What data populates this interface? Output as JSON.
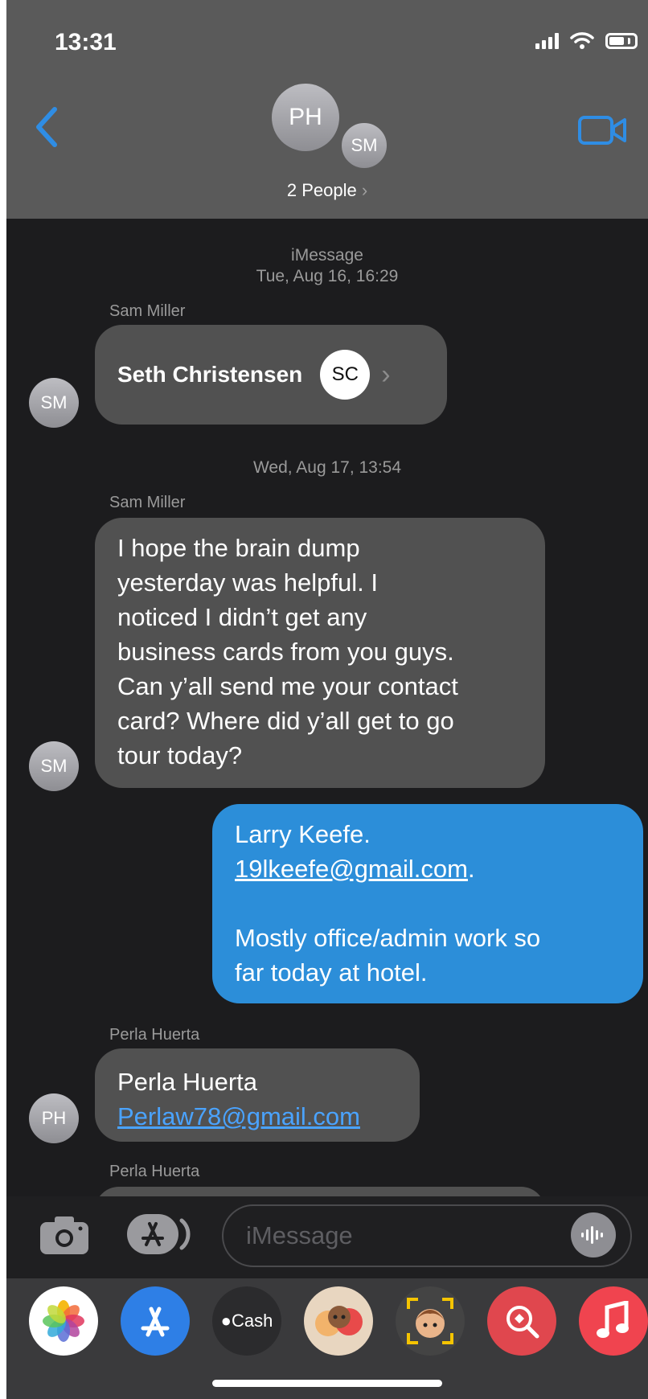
{
  "status": {
    "time": "13:31"
  },
  "header": {
    "avatar_primary": "PH",
    "avatar_secondary": "SM",
    "people_label": "2 People",
    "people_chevron": "›"
  },
  "conversation": {
    "service": "iMessage",
    "date1": "Tue, Aug 16, 16:29",
    "date2": "Wed, Aug 17, 13:54",
    "messages": [
      {
        "sender": "Sam Miller",
        "avatar": "SM",
        "type": "contact",
        "contact_name": "Seth Christensen",
        "contact_initials": "SC",
        "chevron": "›"
      },
      {
        "sender": "Sam Miller",
        "avatar": "SM",
        "type": "text",
        "lines": [
          "I hope the brain dump",
          "yesterday was helpful. I",
          "noticed I didn’t get any",
          "business cards from you guys.",
          "Can y’all send me your contact",
          "card? Where did y’all get to go",
          "tour today?"
        ]
      },
      {
        "sender": "me",
        "type": "text",
        "line1": "Larry Keefe.",
        "email": "19lkeefe@gmail.com",
        "email_suffix": ".",
        "line3": "Mostly office/admin work so",
        "line4": "far today at hotel."
      },
      {
        "sender": "Perla Huerta",
        "avatar": "PH",
        "type": "text",
        "name": "Perla Huerta",
        "email": "Perlaw78@gmail.com"
      },
      {
        "sender": "Perla Huerta",
        "type": "text-partial"
      }
    ]
  },
  "input": {
    "placeholder": "iMessage"
  },
  "app_drawer": {
    "icons": [
      "photos-icon",
      "app-store-icon",
      "apple-cash-icon",
      "memoji-stickers-icon",
      "memoji-icon",
      "image-search-icon",
      "music-icon"
    ],
    "cash_label": "Cash"
  },
  "colors": {
    "header_bg": "#5a5a5a",
    "incoming_bubble": "#515151",
    "outgoing_bubble": "#2c8ed9",
    "link_blue": "#4aa3ff",
    "accent_blue": "#2f8de4"
  }
}
